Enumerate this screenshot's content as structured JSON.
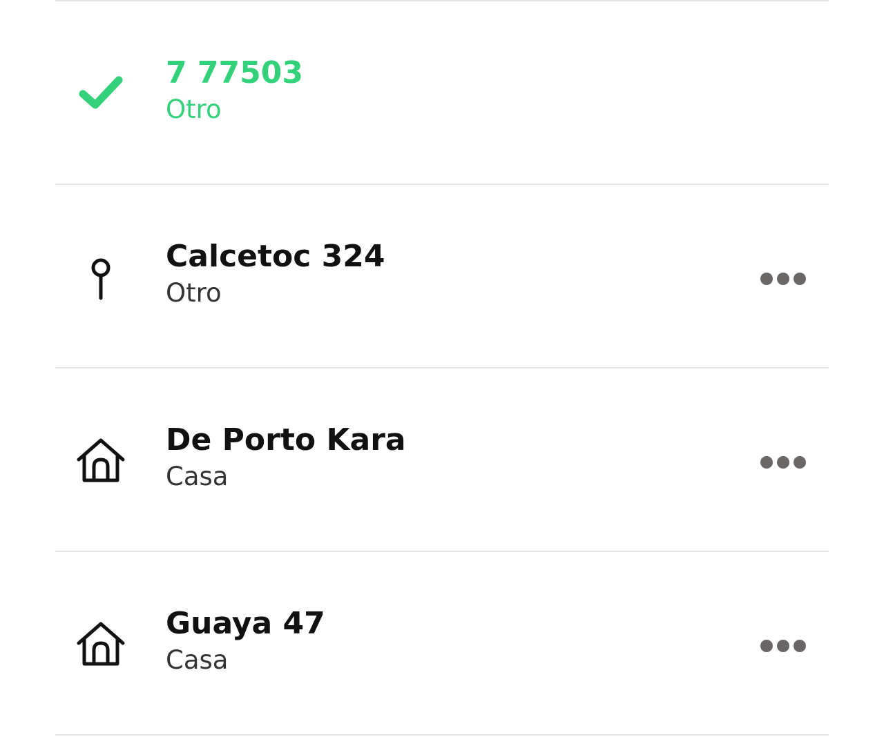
{
  "colors": {
    "accent": "#33d17a",
    "text_primary": "#111111",
    "text_secondary": "#333333",
    "more_dots": "#6b6666",
    "divider": "#e5e5e5"
  },
  "addresses": [
    {
      "title": "7 77503",
      "subtitle": "Otro",
      "icon": "check-icon",
      "selected": true,
      "has_menu": false
    },
    {
      "title": "Calcetoc 324",
      "subtitle": "Otro",
      "icon": "location-pin-icon",
      "selected": false,
      "has_menu": true,
      "menu_icon": "more-options-icon"
    },
    {
      "title": "De Porto Kara",
      "subtitle": "Casa",
      "icon": "home-icon",
      "selected": false,
      "has_menu": true,
      "menu_icon": "more-options-icon"
    },
    {
      "title": "Guaya 47",
      "subtitle": "Casa",
      "icon": "home-icon",
      "selected": false,
      "has_menu": true,
      "menu_icon": "more-options-icon"
    }
  ]
}
